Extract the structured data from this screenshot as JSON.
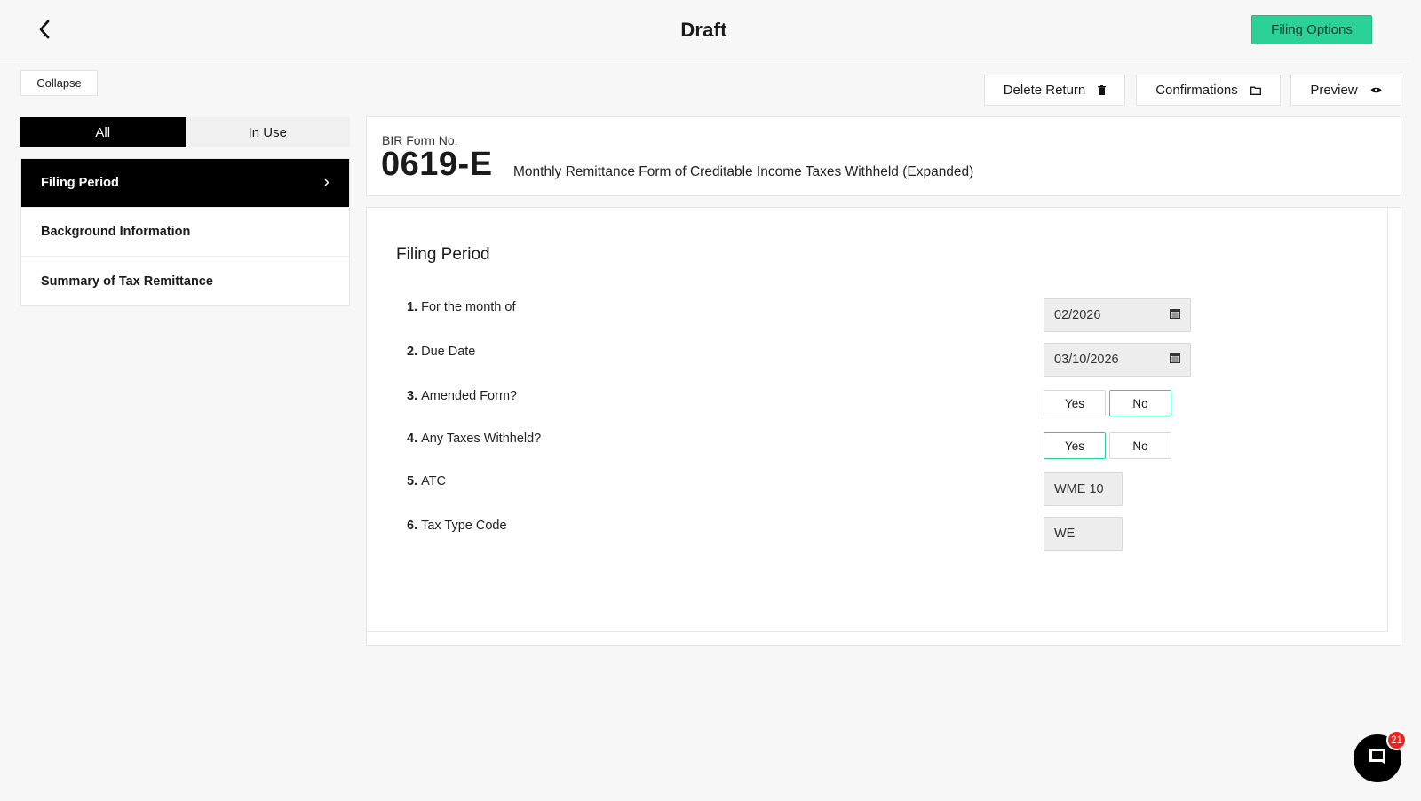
{
  "header": {
    "title": "Draft",
    "filing_options_label": "Filing Options"
  },
  "toolbar": {
    "collapse_label": "Collapse",
    "delete_label": "Delete Return",
    "confirmations_label": "Confirmations",
    "preview_label": "Preview"
  },
  "sidebar": {
    "segments": [
      {
        "label": "All",
        "active": true
      },
      {
        "label": "In Use",
        "active": false
      }
    ],
    "items": [
      {
        "label": "Filing Period",
        "active": true
      },
      {
        "label": "Background Information",
        "active": false
      },
      {
        "label": "Summary of Tax Remittance",
        "active": false
      }
    ]
  },
  "form": {
    "number_label": "BIR Form No.",
    "number": "0619-E",
    "description": "Monthly Remittance Form of Creditable Income Taxes Withheld (Expanded)"
  },
  "section": {
    "title": "Filing Period",
    "questions": [
      {
        "num": "1.",
        "label": "For the month of",
        "value": "02/2026"
      },
      {
        "num": "2.",
        "label": "Due Date",
        "value": "03/10/2026"
      },
      {
        "num": "3.",
        "label": "Amended Form?",
        "yes": "Yes",
        "no": "No",
        "selected": "No"
      },
      {
        "num": "4.",
        "label": "Any Taxes Withheld?",
        "yes": "Yes",
        "no": "No",
        "selected": "Yes"
      },
      {
        "num": "5.",
        "label": "ATC",
        "value": "WME 10"
      },
      {
        "num": "6.",
        "label": "Tax Type Code",
        "value": "WE"
      }
    ]
  },
  "chat": {
    "badge_count": "21"
  },
  "colors": {
    "accent": "#2bd196",
    "badge": "#e5261f"
  }
}
